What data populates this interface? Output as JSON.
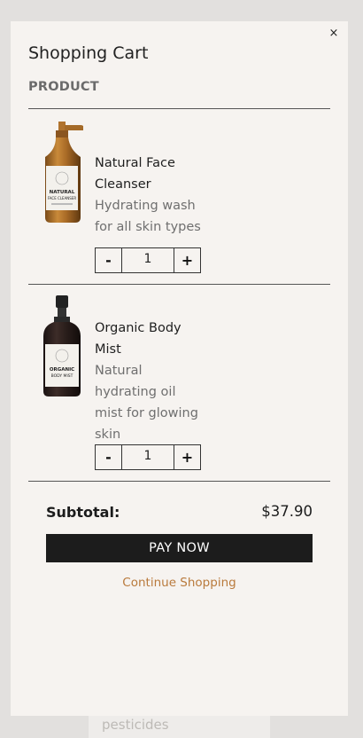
{
  "background": {
    "partial_text": "pesticides"
  },
  "cart": {
    "title": "Shopping Cart",
    "close_label": "×",
    "column_header": "PRODUCT",
    "items": [
      {
        "name_line1": "Natural Face",
        "name_line2": "Cleanser",
        "desc_lines": [
          "Hydrating wash",
          "for all skin types"
        ],
        "quantity": "1",
        "minus_label": "-",
        "plus_label": "+",
        "label_text": [
          "NATURAL",
          "FACE CLEANSER"
        ]
      },
      {
        "name_line1": "Organic Body",
        "name_line2": "Mist",
        "desc_lines": [
          "Natural",
          "hydrating oil",
          "mist for glowing",
          "skin"
        ],
        "quantity": "1",
        "minus_label": "-",
        "plus_label": "+",
        "label_text": [
          "ORGANIC",
          "BODY MIST"
        ]
      }
    ],
    "subtotal_label": "Subtotal:",
    "subtotal_value": "$37.90",
    "pay_label": "PAY NOW",
    "continue_label": "Continue Shopping"
  },
  "colors": {
    "accent_link": "#b97a3c",
    "pay_button": "#1c1c1c",
    "panel_bg": "#f6f3f0"
  }
}
